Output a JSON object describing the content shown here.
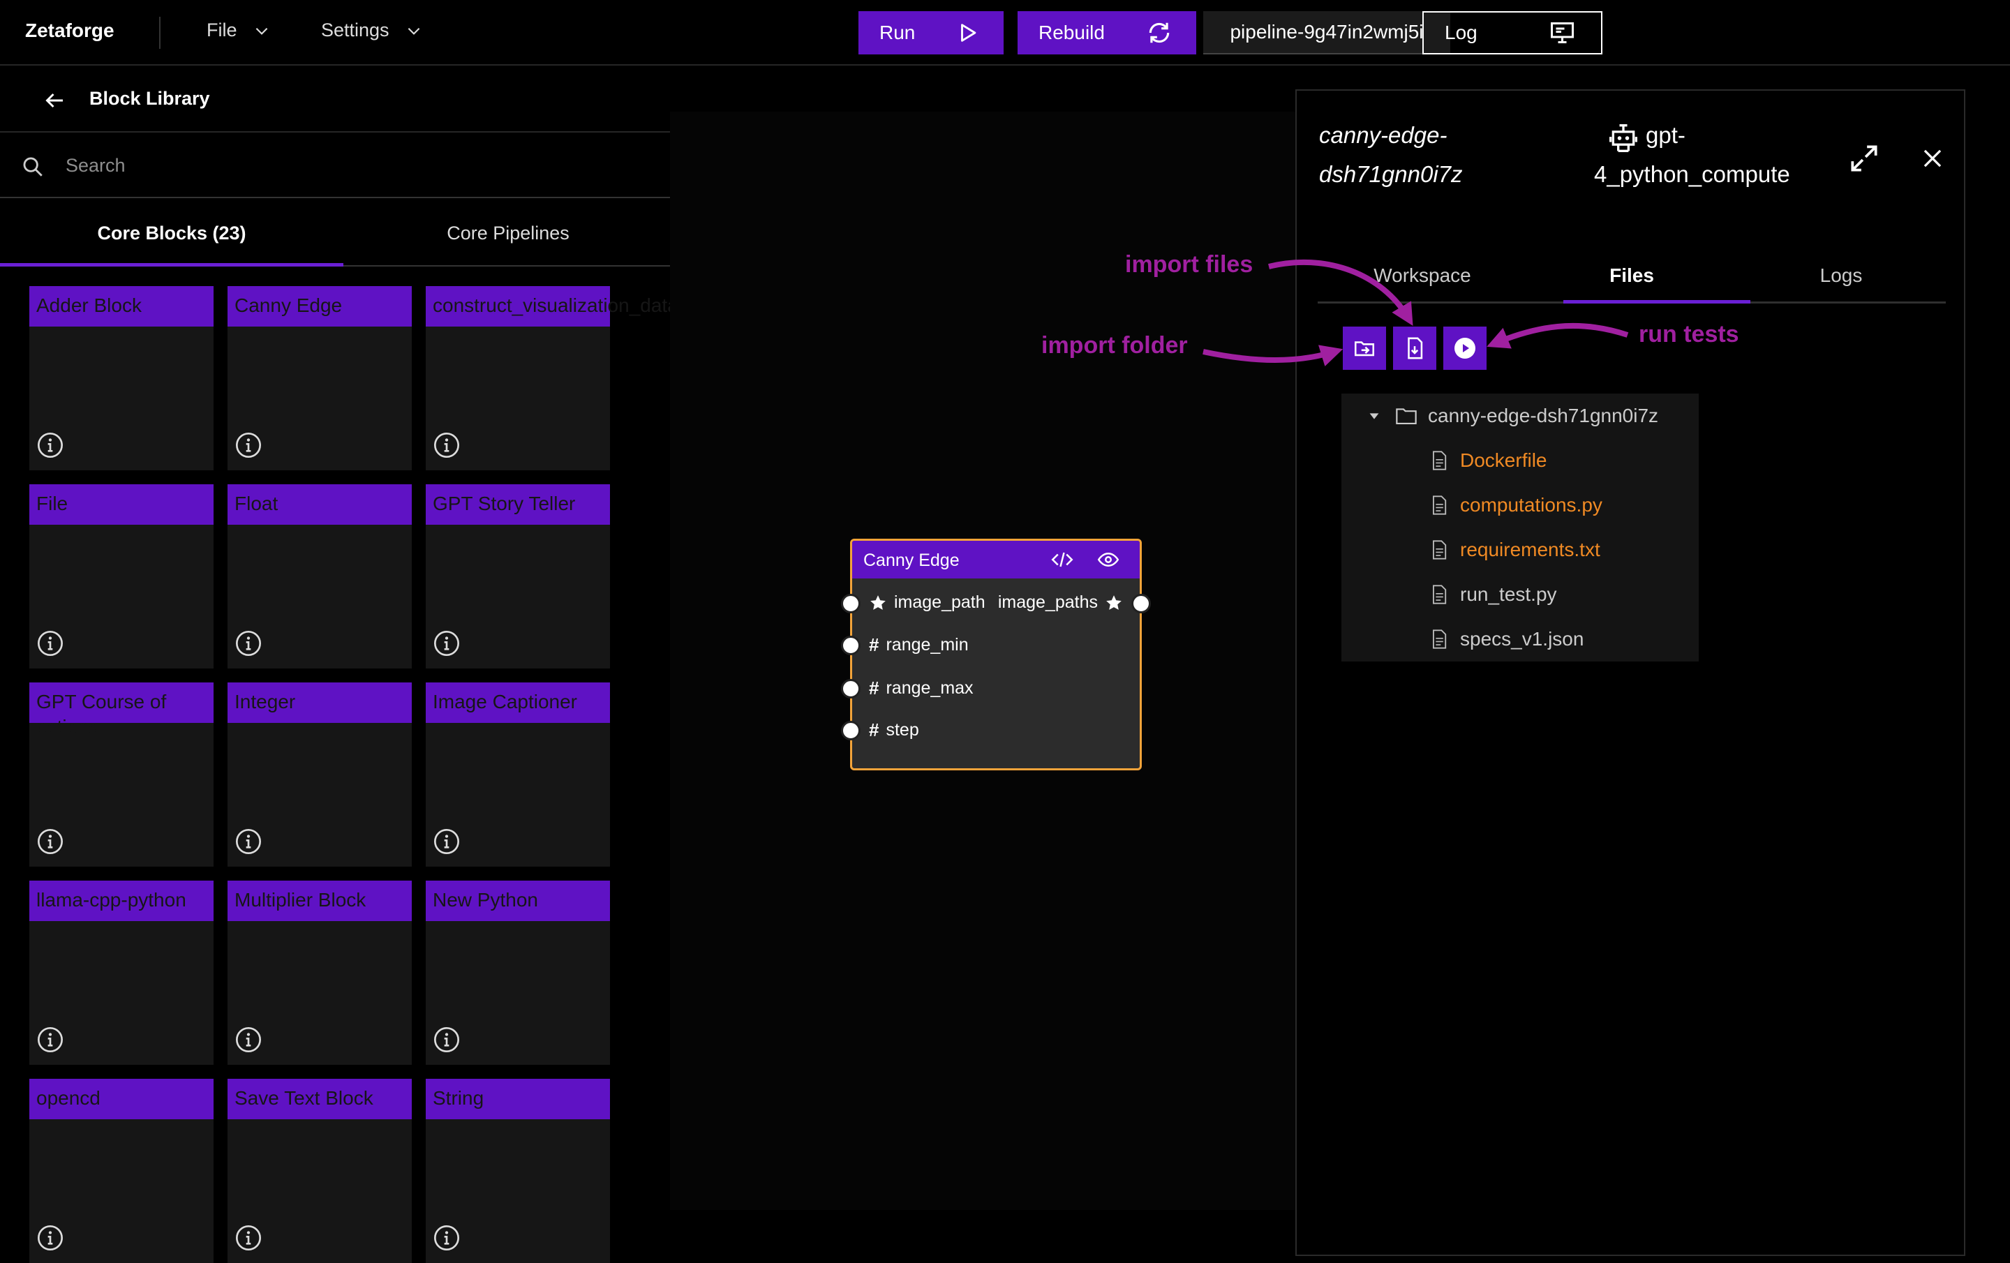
{
  "topbar": {
    "brand": "Zetaforge",
    "menus": [
      {
        "label": "File"
      },
      {
        "label": "Settings"
      }
    ],
    "run_label": "Run",
    "rebuild_label": "Rebuild",
    "pipeline_name": "pipeline-9g47in2wmj5i",
    "log_label": "Log"
  },
  "library": {
    "title": "Block Library",
    "search_placeholder": "Search",
    "tabs": [
      {
        "label": "Core Blocks (23)",
        "active": true
      },
      {
        "label": "Core Pipelines",
        "active": false
      }
    ],
    "blocks": [
      "Adder Block",
      "Canny Edge",
      "construct_visualization_data",
      "File",
      "Float",
      "GPT Story Teller",
      "GPT Course of actions",
      "Integer",
      "Image Captioner",
      "llama-cpp-python",
      "Multiplier Block",
      "New Python",
      "opencd",
      "Save Text Block",
      "String"
    ]
  },
  "node": {
    "title": "Canny Edge",
    "inputs": [
      {
        "name": "image_path",
        "icon": "star-icon"
      },
      {
        "name": "range_min",
        "icon": "hash-icon"
      },
      {
        "name": "range_max",
        "icon": "hash-icon"
      },
      {
        "name": "step",
        "icon": "hash-icon"
      }
    ],
    "outputs": [
      {
        "name": "image_paths",
        "icon": "star-icon"
      }
    ]
  },
  "panel": {
    "block_id_line1": "canny-edge-",
    "block_id_line2": "dsh71gnn0i7z",
    "model_line1": "gpt-",
    "model_line2": "4_python_compute",
    "tabs": [
      {
        "label": "Workspace",
        "active": false
      },
      {
        "label": "Files",
        "active": true
      },
      {
        "label": "Logs",
        "active": false
      }
    ],
    "folder": "canny-edge-dsh71gnn0i7z",
    "files": [
      {
        "name": "Dockerfile",
        "modified": true
      },
      {
        "name": "computations.py",
        "modified": true
      },
      {
        "name": "requirements.txt",
        "modified": true
      },
      {
        "name": "run_test.py",
        "modified": false
      },
      {
        "name": "specs_v1.json",
        "modified": false
      }
    ]
  },
  "annotations": {
    "import_files": "import files",
    "import_folder": "import folder",
    "run_tests": "run tests"
  },
  "colors": {
    "accent": "#5f12c4",
    "node_border": "#f2a33a",
    "modified_file": "#f08a24",
    "annotation": "#a020a0"
  }
}
